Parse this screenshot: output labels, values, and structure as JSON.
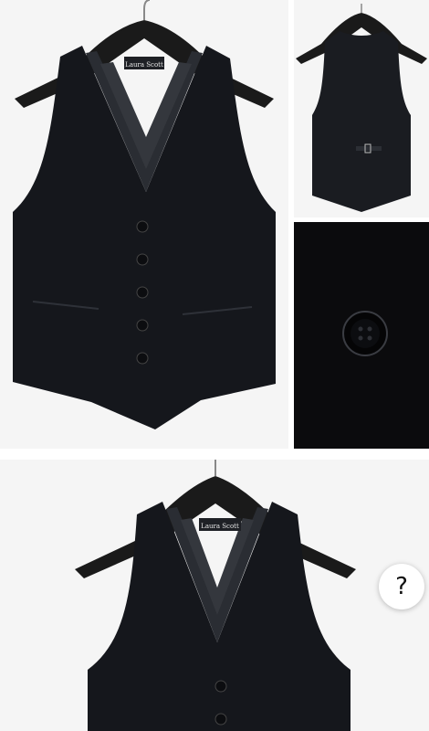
{
  "gallery": {
    "images": [
      {
        "name": "front-view",
        "label": "Laura Scott"
      },
      {
        "name": "back-view"
      },
      {
        "name": "button-closeup"
      },
      {
        "name": "front-view-repeat",
        "label": "Laura Scott"
      }
    ],
    "help_button": {
      "symbol": "?"
    }
  },
  "colors": {
    "background": "#ffffff",
    "photo_bg": "#f4f4f4",
    "vest": "#15171c",
    "lining": "#2a2d33",
    "hanger": "#1a1a1a"
  }
}
